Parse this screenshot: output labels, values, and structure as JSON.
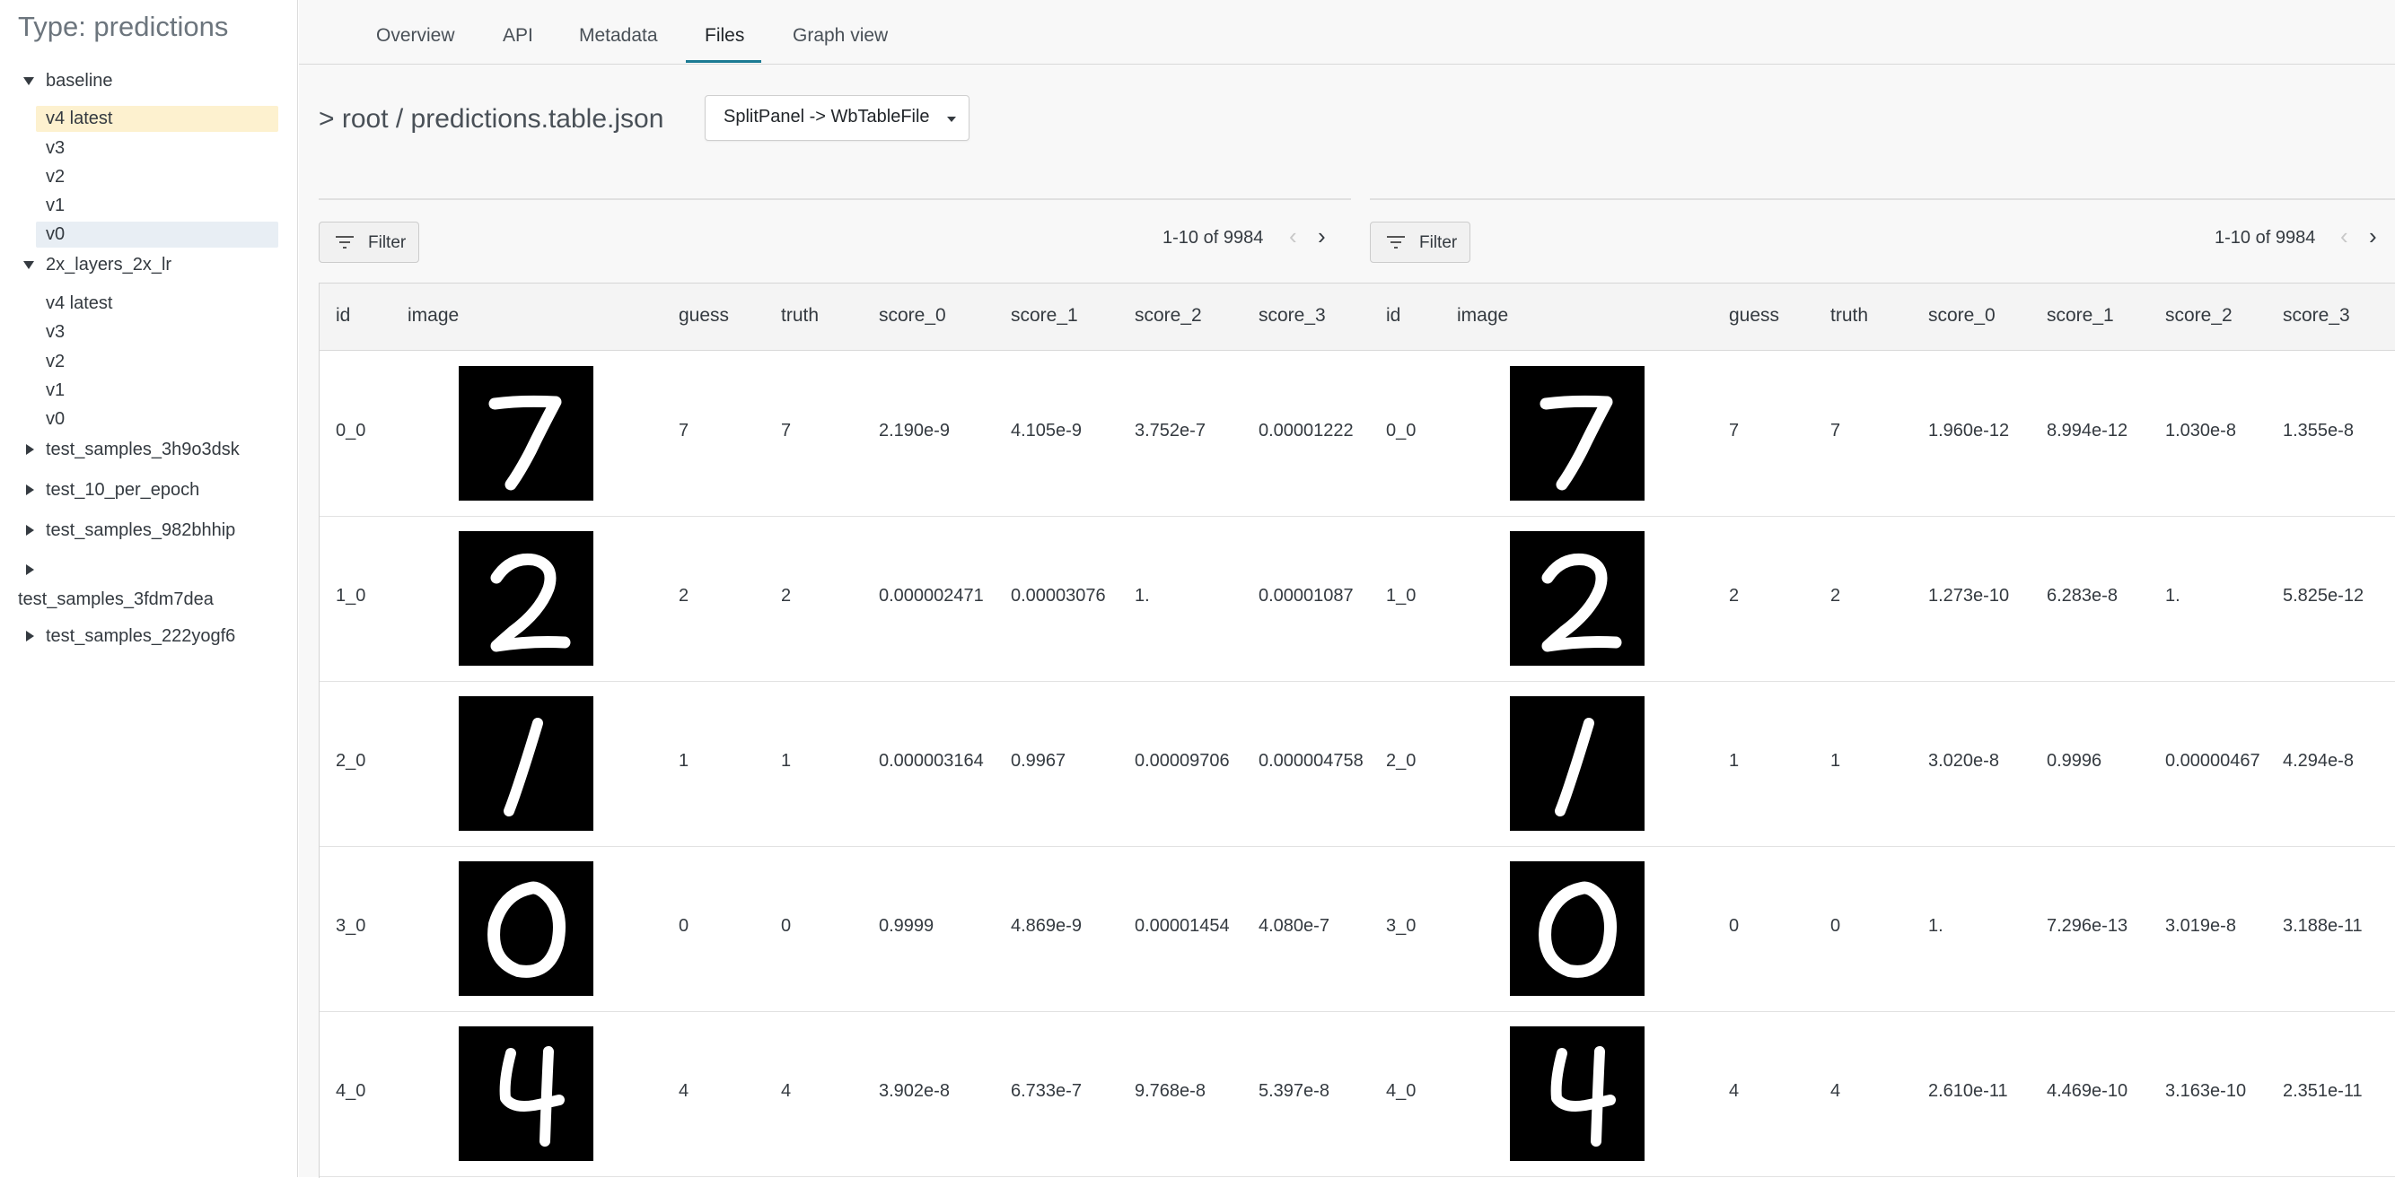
{
  "sidebar": {
    "title": "Type: predictions",
    "groups": [
      {
        "name": "baseline",
        "expanded": true,
        "versions": [
          "v4 latest",
          "v3",
          "v2",
          "v1",
          "v0"
        ]
      },
      {
        "name": "2x_layers_2x_lr",
        "expanded": true,
        "versions": [
          "v4 latest",
          "v3",
          "v2",
          "v1",
          "v0"
        ]
      },
      {
        "name": "test_samples_3h9o3dsk",
        "expanded": false
      },
      {
        "name": "test_10_per_epoch",
        "expanded": false
      },
      {
        "name": "test_samples_982bhhip",
        "expanded": false
      },
      {
        "name": "test_samples_3fdm7dea",
        "expanded": false
      },
      {
        "name": "test_samples_222yogf6",
        "expanded": false
      }
    ]
  },
  "tabs": [
    "Overview",
    "API",
    "Metadata",
    "Files",
    "Graph view"
  ],
  "active_tab": "Files",
  "breadcrumb": "> root / predictions.table.json",
  "panel_select": "SplitPanel -> WbTableFile",
  "filter_label": "Filter",
  "columns": [
    "id",
    "image",
    "guess",
    "truth",
    "score_0",
    "score_1",
    "score_2",
    "score_3"
  ],
  "left_table": {
    "pagination": "1-10 of 9984",
    "rows": [
      {
        "id": "0_0",
        "image": "digit-7",
        "guess": "7",
        "truth": "7",
        "score_0": "2.190e-9",
        "score_1": "4.105e-9",
        "score_2": "3.752e-7",
        "score_3": "0.00001222"
      },
      {
        "id": "1_0",
        "image": "digit-2",
        "guess": "2",
        "truth": "2",
        "score_0": "0.000002471",
        "score_1": "0.00003076",
        "score_2": "1.",
        "score_3": "0.00001087"
      },
      {
        "id": "2_0",
        "image": "digit-1",
        "guess": "1",
        "truth": "1",
        "score_0": "0.000003164",
        "score_1": "0.9967",
        "score_2": "0.00009706",
        "score_3": "0.000004758"
      },
      {
        "id": "3_0",
        "image": "digit-0",
        "guess": "0",
        "truth": "0",
        "score_0": "0.9999",
        "score_1": "4.869e-9",
        "score_2": "0.00001454",
        "score_3": "4.080e-7"
      },
      {
        "id": "4_0",
        "image": "digit-4",
        "guess": "4",
        "truth": "4",
        "score_0": "3.902e-8",
        "score_1": "6.733e-7",
        "score_2": "9.768e-8",
        "score_3": "5.397e-8"
      }
    ]
  },
  "right_table": {
    "pagination": "1-10 of 9984",
    "rows": [
      {
        "id": "0_0",
        "image": "digit-7",
        "guess": "7",
        "truth": "7",
        "score_0": "1.960e-12",
        "score_1": "8.994e-12",
        "score_2": "1.030e-8",
        "score_3": "1.355e-8"
      },
      {
        "id": "1_0",
        "image": "digit-2",
        "guess": "2",
        "truth": "2",
        "score_0": "1.273e-10",
        "score_1": "6.283e-8",
        "score_2": "1.",
        "score_3": "5.825e-12"
      },
      {
        "id": "2_0",
        "image": "digit-1",
        "guess": "1",
        "truth": "1",
        "score_0": "3.020e-8",
        "score_1": "0.9996",
        "score_2": "0.00000467",
        "score_3": "4.294e-8"
      },
      {
        "id": "3_0",
        "image": "digit-0",
        "guess": "0",
        "truth": "0",
        "score_0": "1.",
        "score_1": "7.296e-13",
        "score_2": "3.019e-8",
        "score_3": "3.188e-11"
      },
      {
        "id": "4_0",
        "image": "digit-4",
        "guess": "4",
        "truth": "4",
        "score_0": "2.610e-11",
        "score_1": "4.469e-10",
        "score_2": "3.163e-10",
        "score_3": "2.351e-11"
      }
    ]
  },
  "colors": {
    "accent": "#1b7a93",
    "selected_version_bg": "#fdf1cf",
    "hover_version_bg": "#e8eef4"
  },
  "icons": [
    "caret-down-icon",
    "caret-right-icon",
    "filter-icon",
    "chevron-left-icon",
    "chevron-right-icon",
    "dropdown-caret-icon"
  ]
}
